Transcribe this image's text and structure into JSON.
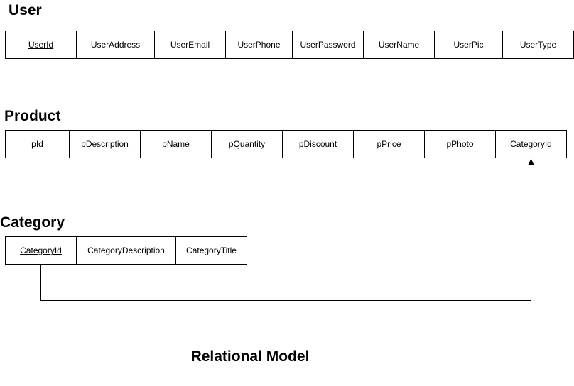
{
  "entities": {
    "user": {
      "title": "User",
      "attributes": [
        {
          "label": "UserId",
          "primary_key": true
        },
        {
          "label": "UserAddress",
          "primary_key": false
        },
        {
          "label": "UserEmail",
          "primary_key": false
        },
        {
          "label": "UserPhone",
          "primary_key": false
        },
        {
          "label": "UserPassword",
          "primary_key": false
        },
        {
          "label": "UserName",
          "primary_key": false
        },
        {
          "label": "UserPic",
          "primary_key": false
        },
        {
          "label": "UserType",
          "primary_key": false
        }
      ]
    },
    "product": {
      "title": "Product",
      "attributes": [
        {
          "label": "pId",
          "primary_key": true
        },
        {
          "label": "pDescription",
          "primary_key": false
        },
        {
          "label": "pName",
          "primary_key": false
        },
        {
          "label": "pQuantity",
          "primary_key": false
        },
        {
          "label": "pDiscount",
          "primary_key": false
        },
        {
          "label": "pPrice",
          "primary_key": false
        },
        {
          "label": "pPhoto",
          "primary_key": false
        },
        {
          "label": "CategoryId",
          "primary_key": true
        }
      ]
    },
    "category": {
      "title": "Category",
      "attributes": [
        {
          "label": "CategoryId",
          "primary_key": true
        },
        {
          "label": "CategoryDescription",
          "primary_key": false
        },
        {
          "label": "CategoryTitle",
          "primary_key": false
        }
      ]
    }
  },
  "relationship": {
    "from": "category.CategoryId",
    "to": "product.CategoryId"
  },
  "footer": {
    "label": "Relational Model"
  }
}
